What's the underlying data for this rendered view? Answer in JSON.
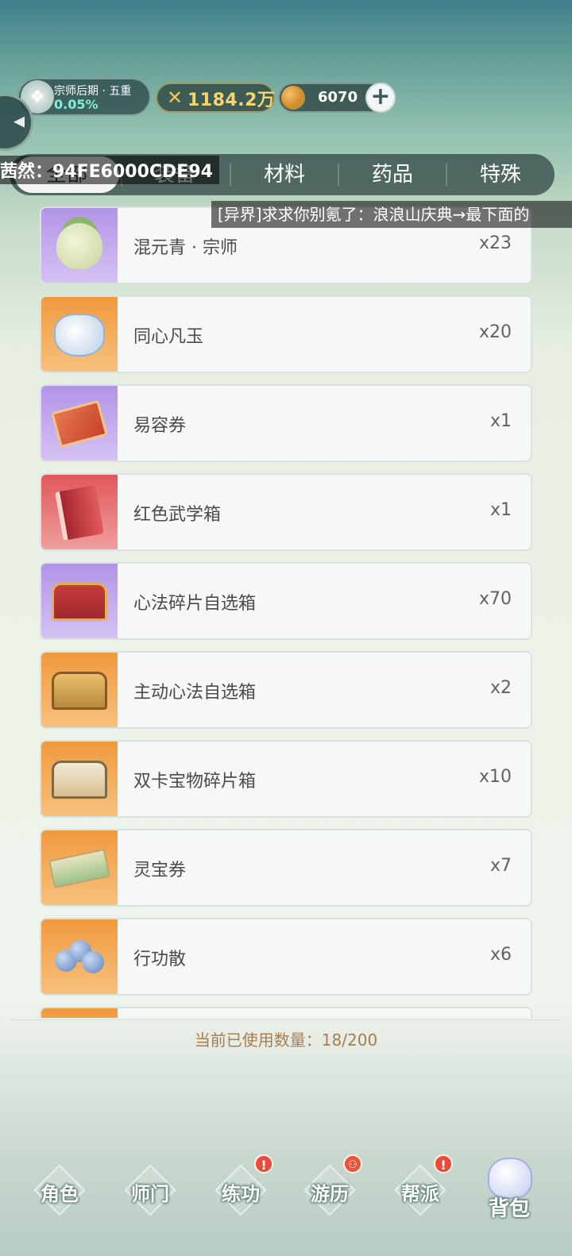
{
  "status": {
    "rank_title": "宗师后期 · 五重",
    "rank_progress": "0.05%",
    "power": "1184.2万",
    "coins": "6070"
  },
  "overlay": "茜然：94FE6000CDE94",
  "tabs": [
    "全部",
    "装备",
    "材料",
    "药品",
    "特殊"
  ],
  "marquee": "[异界]求求你别氪了：浪浪山庆典→最下面的",
  "items": [
    {
      "name": "混元青 · 宗师",
      "count": "x23"
    },
    {
      "name": "同心凡玉",
      "count": "x20"
    },
    {
      "name": "易容券",
      "count": "x1"
    },
    {
      "name": "红色武学箱",
      "count": "x1"
    },
    {
      "name": "心法碎片自选箱",
      "count": "x70"
    },
    {
      "name": "主动心法自选箱",
      "count": "x2"
    },
    {
      "name": "双卡宝物碎片箱",
      "count": "x10"
    },
    {
      "name": "灵宝券",
      "count": "x7"
    },
    {
      "name": "行功散",
      "count": "x6"
    }
  ],
  "usage": "当前已使用数量：18/200",
  "nav": [
    "角色",
    "师门",
    "练功",
    "游历",
    "帮派",
    "背包"
  ],
  "badges": {
    "alert": "!",
    "coin": "⚇"
  }
}
